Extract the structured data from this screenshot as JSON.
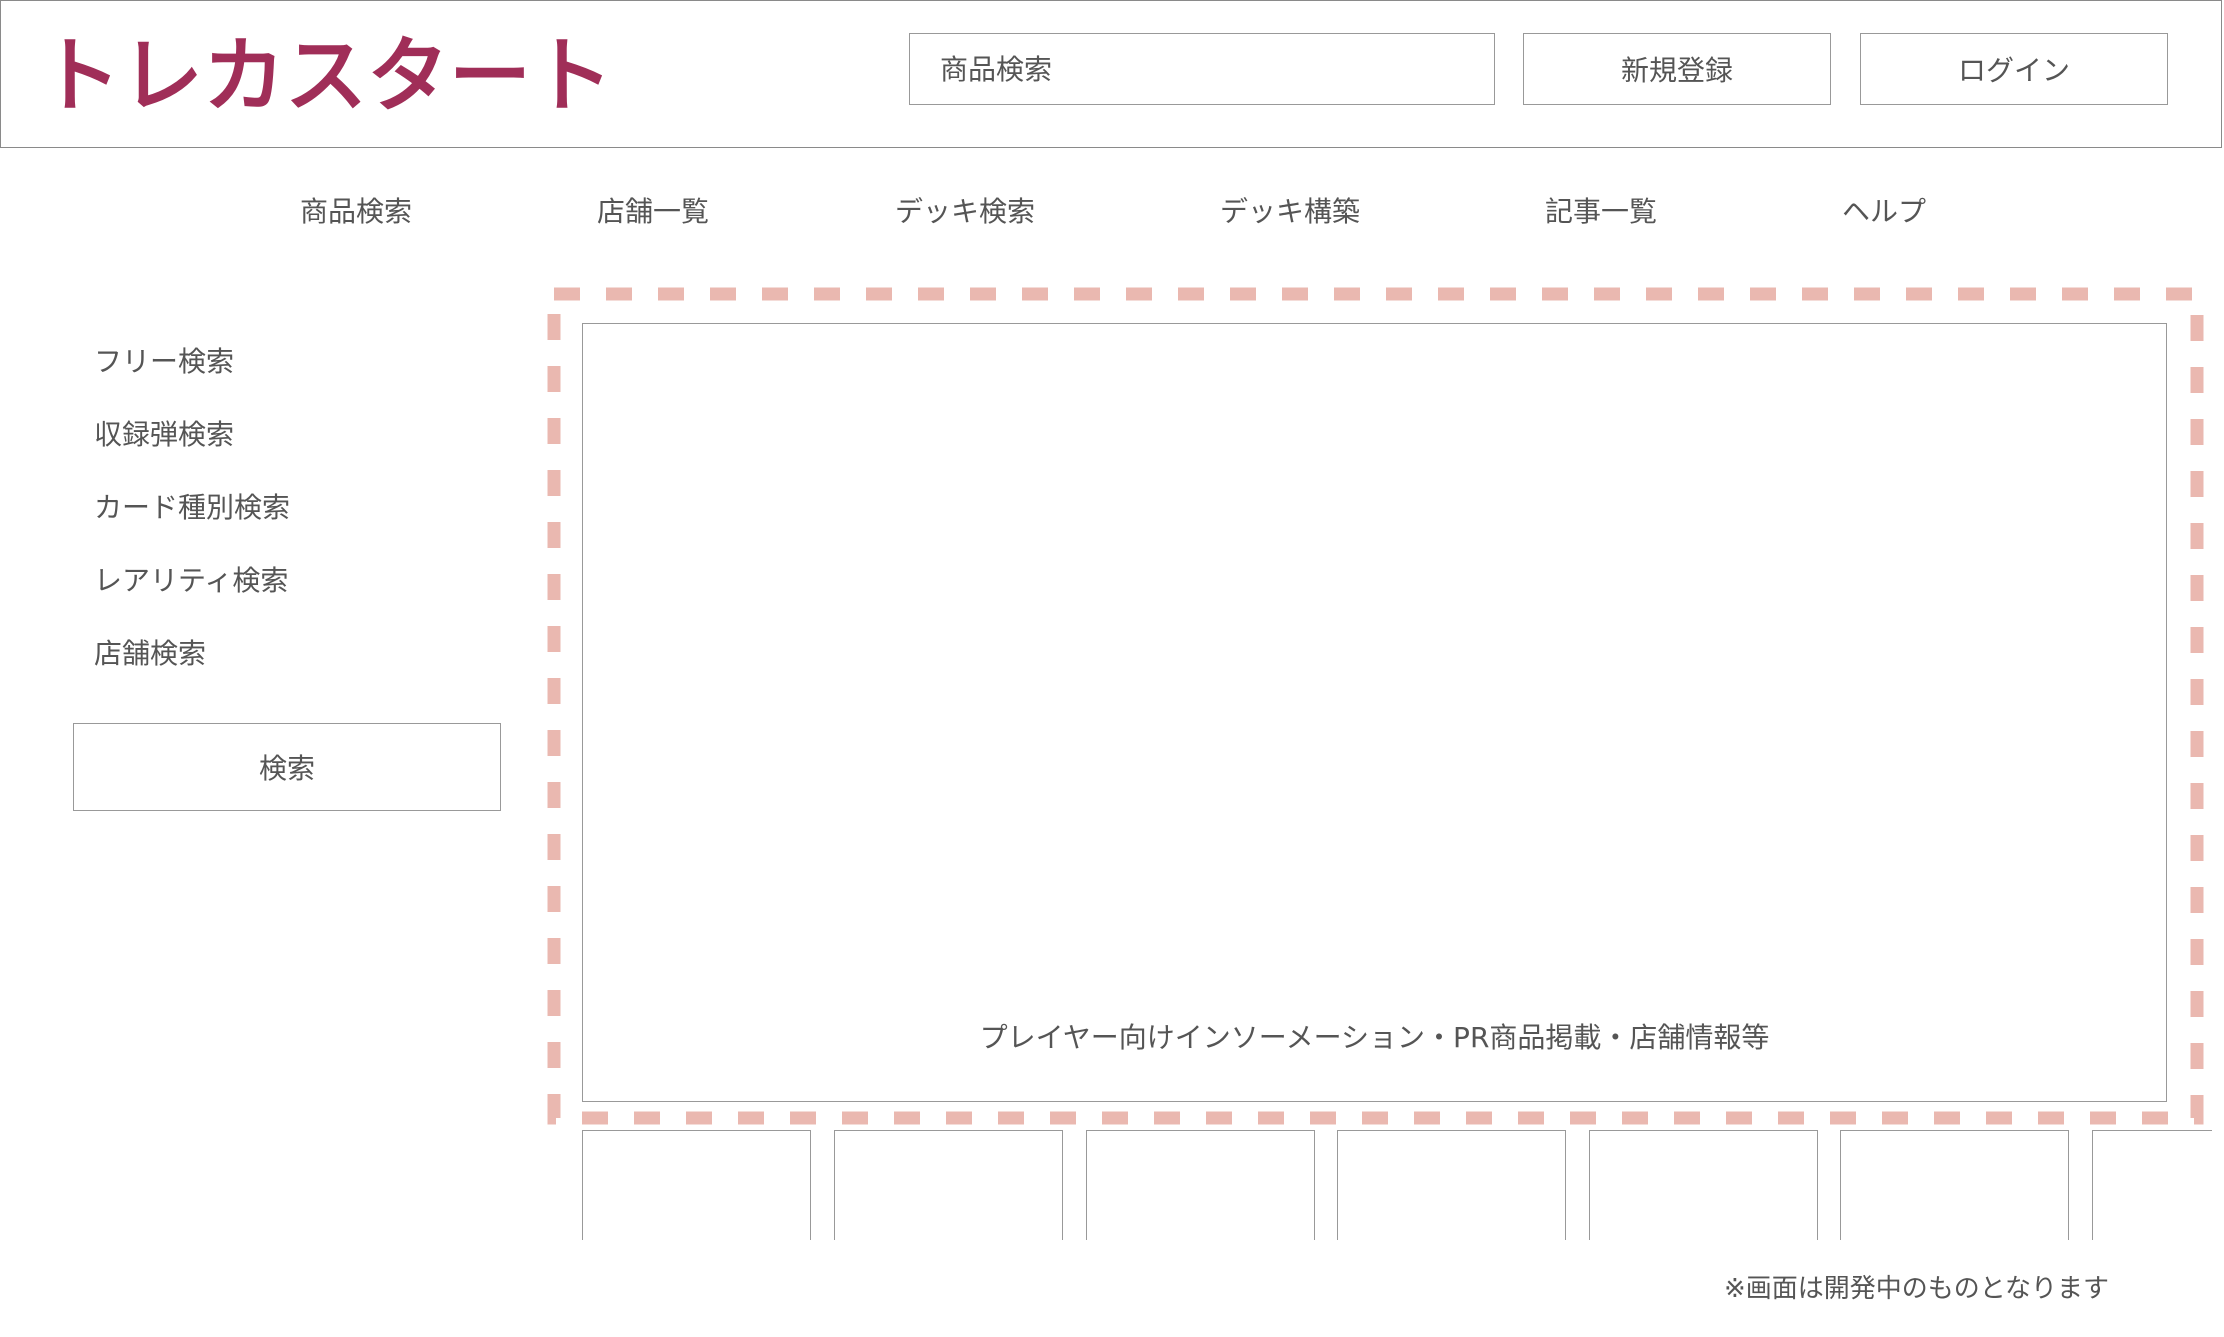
{
  "header": {
    "logo_text": "トレカスタート",
    "search_placeholder": "商品検索",
    "register_label": "新規登録",
    "login_label": "ログイン"
  },
  "nav": {
    "items": [
      "商品検索",
      "店舗一覧",
      "デッキ検索",
      "デッキ構築",
      "記事一覧",
      "ヘルプ"
    ]
  },
  "sidebar": {
    "items": [
      "フリー検索",
      "収録弾検索",
      "カード種別検索",
      "レアリティ検索",
      "店舗検索"
    ],
    "search_button": "検索"
  },
  "banner": {
    "text": "プレイヤー向けインソーメーション・PR商品掲載・店舗情報等"
  },
  "footnote": "※画面は開発中のものとなります",
  "colors": {
    "brand": "#a02e58",
    "highlight_dash": "#eab8b0",
    "border": "#999999",
    "text": "#555555"
  }
}
